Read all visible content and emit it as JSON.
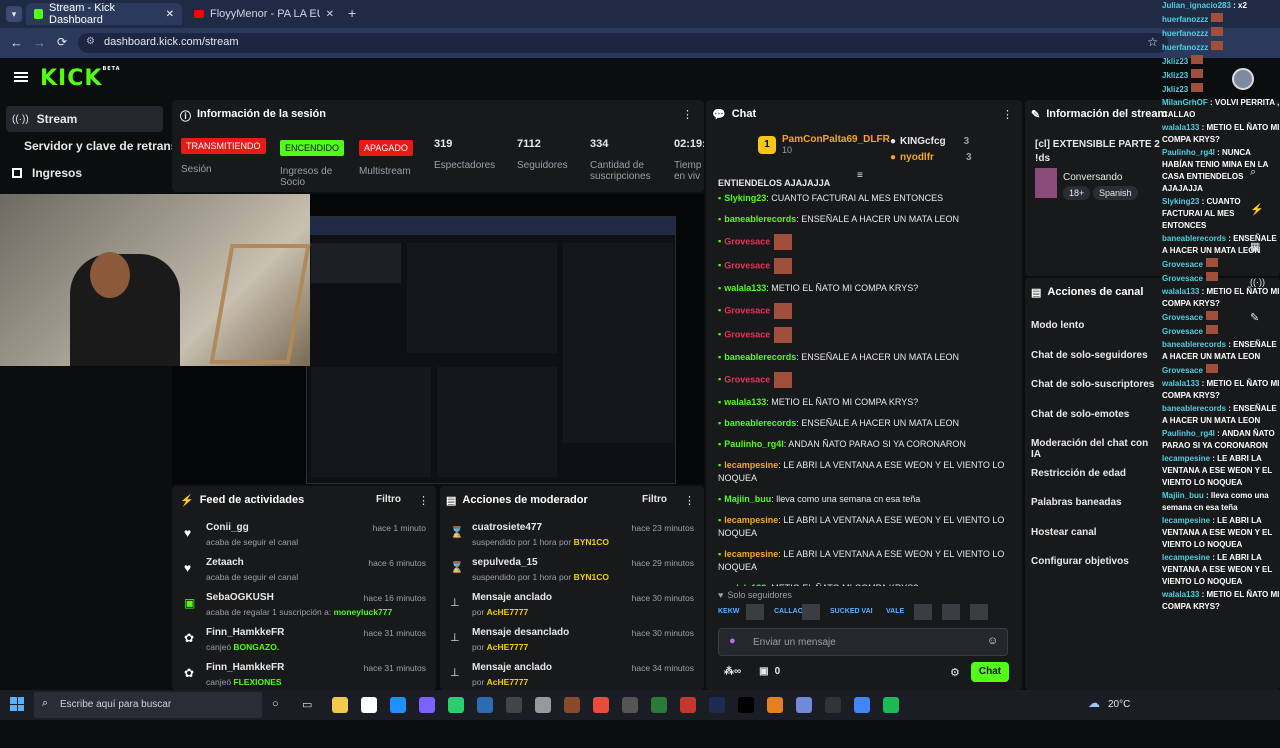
{
  "browser": {
    "tabs": [
      {
        "label": "Stream - Kick Dashboard",
        "active": true
      },
      {
        "label": "FloyyMenor - PA LA EUROPA - ",
        "active": false
      }
    ],
    "url": "dashboard.kick.com/stream"
  },
  "sidebar": {
    "logo": "KICK",
    "logo_sup": "BETA",
    "items": [
      {
        "label": "Stream"
      },
      {
        "label": "Servidor y clave de retransm"
      },
      {
        "label": "Ingresos"
      }
    ]
  },
  "session": {
    "title": "Información de la sesión",
    "badges": [
      {
        "label": "TRANSMITIENDO",
        "sub": "Sesión",
        "color": "#e91916"
      },
      {
        "label": "ENCENDIDO",
        "sub": "Ingresos de Socio",
        "color": "#53fc18"
      },
      {
        "label": "APAGADO",
        "sub": "Multistream",
        "color": "#e91916"
      }
    ],
    "stats": [
      {
        "value": "319",
        "label": "Espectadores"
      },
      {
        "value": "7112",
        "label": "Seguidores"
      },
      {
        "value": "334",
        "label": "Cantidad de suscripciones"
      },
      {
        "value": "02:19:",
        "label": "Tiemp en viv"
      }
    ]
  },
  "feed": {
    "title": "Feed de actividades",
    "filter": "Filtro",
    "items": [
      {
        "user": "Conii_gg",
        "time": "hace 1 minuto",
        "desc": "acaba de seguir el canal",
        "extra": ""
      },
      {
        "user": "Zetaach",
        "time": "hace 6 minutos",
        "desc": "acaba de seguir el canal",
        "extra": ""
      },
      {
        "user": "SebaOGKUSH",
        "time": "hace 16 minutos",
        "desc": "acaba de regalar 1 suscripción a:",
        "extra": "moneyluck777"
      },
      {
        "user": "Finn_HamkkeFR",
        "time": "hace 31 minutos",
        "desc": "canjeó",
        "extra": "BONGAZO."
      },
      {
        "user": "Finn_HamkkeFR",
        "time": "hace 31 minutos",
        "desc": "canjeó",
        "extra": "FLEXIONES"
      }
    ]
  },
  "modactions": {
    "title": "Acciones de moderador",
    "filter": "Filtro",
    "items": [
      {
        "title": "cuatrosiete477",
        "time": "hace 23 minutos",
        "desc": "suspendido por 1 hora por",
        "extra": "BYN1CO"
      },
      {
        "title": "sepulveda_15",
        "time": "hace 29 minutos",
        "desc": "suspendido por 1 hora por",
        "extra": "BYN1CO"
      },
      {
        "title": "Mensaje anclado",
        "time": "hace 30 minutos",
        "desc": "por",
        "extra": "AcHE7777"
      },
      {
        "title": "Mensaje desanclado",
        "time": "hace 30 minutos",
        "desc": "por",
        "extra": "AcHE7777"
      },
      {
        "title": "Mensaje anclado",
        "time": "hace 34 minutos",
        "desc": "por",
        "extra": "AcHE7777"
      }
    ]
  },
  "chat": {
    "title": "Chat",
    "top1": {
      "name": "PamConPalta69_DLFR",
      "rank": "1",
      "points": "10"
    },
    "top2": {
      "name": "KINGcfcg",
      "points": "3"
    },
    "top3": {
      "name": "nyodlfr",
      "points": "3"
    },
    "cut_line": "ENTIENDELOS AJAJAJJA",
    "messages": [
      {
        "user": "Slyking23",
        "color": "#53fc18",
        "text": "CUANTO FACTURAI AL MES ENTONCES"
      },
      {
        "user": "baneablerecords",
        "color": "#53fc18",
        "text": "ENSEÑALE A HACER UN MATA LEON"
      },
      {
        "user": "Grovesace",
        "color": "#e9305a",
        "text": ""
      },
      {
        "user": "Grovesace",
        "color": "#e9305a",
        "text": ""
      },
      {
        "user": "walala133",
        "color": "#53fc18",
        "text": "METIO EL ÑATO MI COMPA KRYS?"
      },
      {
        "user": "Grovesace",
        "color": "#e9305a",
        "text": ""
      },
      {
        "user": "Grovesace",
        "color": "#e9305a",
        "text": ""
      },
      {
        "user": "baneablerecords",
        "color": "#53fc18",
        "text": "ENSEÑALE A HACER UN MATA LEON"
      },
      {
        "user": "Grovesace",
        "color": "#e9305a",
        "text": ""
      },
      {
        "user": "walala133",
        "color": "#53fc18",
        "text": "METIO EL ÑATO MI COMPA KRYS?"
      },
      {
        "user": "baneablerecords",
        "color": "#53fc18",
        "text": "ENSEÑALE A HACER UN MATA LEON"
      },
      {
        "user": "Paulinho_rg4l",
        "color": "#53fc18",
        "text": "ANDAN ÑATO PARAO SI YA CORONARON"
      },
      {
        "user": "lecampesine",
        "color": "#f5a623",
        "text": "LE ABRI LA VENTANA A ESE WEON Y EL VIENTO LO NOQUEA"
      },
      {
        "user": "Majiin_buu",
        "color": "#53fc18",
        "text": "lleva como una semana cn esa teña"
      },
      {
        "user": "lecampesine",
        "color": "#f5a623",
        "text": "LE ABRI LA VENTANA A ESE WEON Y EL VIENTO LO NOQUEA"
      },
      {
        "user": "lecampesine",
        "color": "#f5a623",
        "text": "LE ABRI LA VENTANA A ESE WEON Y EL VIENTO LO NOQUEA"
      },
      {
        "user": "walala133",
        "color": "#53fc18",
        "text": "METIO EL ÑATO MI COMPA KRYS?"
      }
    ],
    "mode": "Solo seguidores",
    "emotes": [
      "KEKW",
      "",
      "CALLAO",
      "",
      "SUCKED",
      "VAI",
      "VALE",
      "",
      "",
      ""
    ],
    "placeholder": "Enviar un mensaje",
    "points": "0",
    "send_label": "Chat"
  },
  "streaminfo": {
    "title": "Información del stream",
    "stream_title": "[cl] EXTENSIBLE PARTE 2",
    "commands": "!ds",
    "category": "Conversando",
    "tags": [
      "18+",
      "Spanish"
    ]
  },
  "channelactions": {
    "title": "Acciones de canal",
    "items": [
      "Modo lento",
      "Chat de solo-seguidores",
      "Chat de solo-suscriptores",
      "Chat de solo-emotes",
      "Moderación del chat con IA",
      "Restricción de edad",
      "Palabras baneadas",
      "Hostear canal",
      "Configurar objetivos"
    ]
  },
  "overlay_chat": [
    {
      "user": "Julian_ignacio283",
      "text": "x2"
    },
    {
      "user": "huerfanozzz",
      "text": ""
    },
    {
      "user": "huerfanozzz",
      "text": ""
    },
    {
      "user": "huerfanozzz",
      "text": ""
    },
    {
      "user": "Jkliz23",
      "text": ""
    },
    {
      "user": "Jkliz23",
      "text": ""
    },
    {
      "user": "Jkliz23",
      "text": ""
    },
    {
      "user": "MilanGrhOF",
      "text": "VOLVI PERRITA , CALLAO"
    },
    {
      "user": "walala133",
      "text": "METIO EL ÑATO MI COMPA KRYS?"
    },
    {
      "user": "Paulinho_rg4l",
      "text": "NUNCA HABÍAN TENIO MINA EN LA CASA ENTIENDELOS AJAJAJJA"
    },
    {
      "user": "Slyking23",
      "text": "CUANTO FACTURAI AL MES ENTONCES"
    },
    {
      "user": "baneablerecords",
      "text": "ENSEÑALE A HACER UN MATA LEON"
    },
    {
      "user": "Grovesace",
      "text": ""
    },
    {
      "user": "Grovesace",
      "text": ""
    },
    {
      "user": "walala133",
      "text": "METIO EL ÑATO MI COMPA KRYS?"
    },
    {
      "user": "Grovesace",
      "text": ""
    },
    {
      "user": "Grovesace",
      "text": ""
    },
    {
      "user": "baneablerecords",
      "text": "ENSEÑALE A HACER UN MATA LEON"
    },
    {
      "user": "Grovesace",
      "text": ""
    },
    {
      "user": "walala133",
      "text": "METIO EL ÑATO MI COMPA KRYS?"
    },
    {
      "user": "baneablerecords",
      "text": "ENSEÑALE A HACER UN MATA LEON"
    },
    {
      "user": "Paulinho_rg4l",
      "text": "ANDAN ÑATO PARAO SI YA CORONARON"
    },
    {
      "user": "lecampesine",
      "text": "LE ABRI LA VENTANA A ESE WEON Y EL VIENTO LO NOQUEA"
    },
    {
      "user": "Majiin_buu",
      "text": "lleva como una semana cn esa teña"
    },
    {
      "user": "lecampesine",
      "text": "LE ABRI LA VENTANA A ESE WEON Y EL VIENTO LO NOQUEA"
    },
    {
      "user": "lecampesine",
      "text": "LE ABRI LA VENTANA A ESE WEON Y EL VIENTO LO NOQUEA"
    },
    {
      "user": "walala133",
      "text": "METIO EL ÑATO MI COMPA KRYS?"
    }
  ],
  "taskbar": {
    "search_placeholder": "Escribe aquí para buscar",
    "weather": "20°C"
  },
  "colors": {
    "accent": "#53fc18",
    "danger": "#e91916",
    "panel": "#18191b"
  }
}
